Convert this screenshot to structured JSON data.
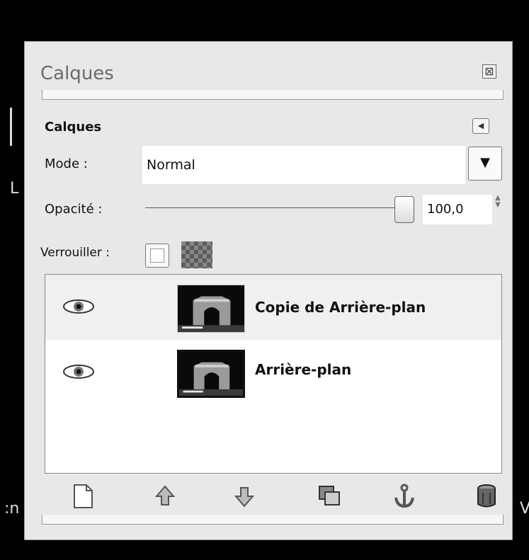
{
  "background_fragments": {
    "left_mid": "L",
    "left_bottom": ":n",
    "right_bottom": "V"
  },
  "dock": {
    "title": "Calques",
    "close_icon": "close-box-icon"
  },
  "panel": {
    "title": "Calques",
    "menu_icon": "panel-menu-triangle-icon",
    "mode": {
      "label": "Mode :",
      "value": "Normal",
      "dropdown_icon": "chevron-down-icon"
    },
    "opacity": {
      "label": "Opacité :",
      "value": "100,0",
      "level": 100
    },
    "lock": {
      "label": "Verrouiller :",
      "pixels_locked": false,
      "alpha_icon": "checkerboard-alpha-icon"
    }
  },
  "layers": [
    {
      "name": "Copie de Arrière-plan",
      "visible": true,
      "selected": true
    },
    {
      "name": "Arrière-plan",
      "visible": true,
      "selected": false
    }
  ],
  "toolbar": {
    "icons": [
      "new-layer-icon",
      "raise-layer-icon",
      "lower-layer-icon",
      "duplicate-layer-icon",
      "anchor-icon",
      "trash-icon"
    ]
  },
  "colors": {
    "window_bg": "#000000",
    "panel_bg": "#e8e8e8",
    "list_bg": "#ffffff",
    "selected_row": "#f0f0f0"
  }
}
